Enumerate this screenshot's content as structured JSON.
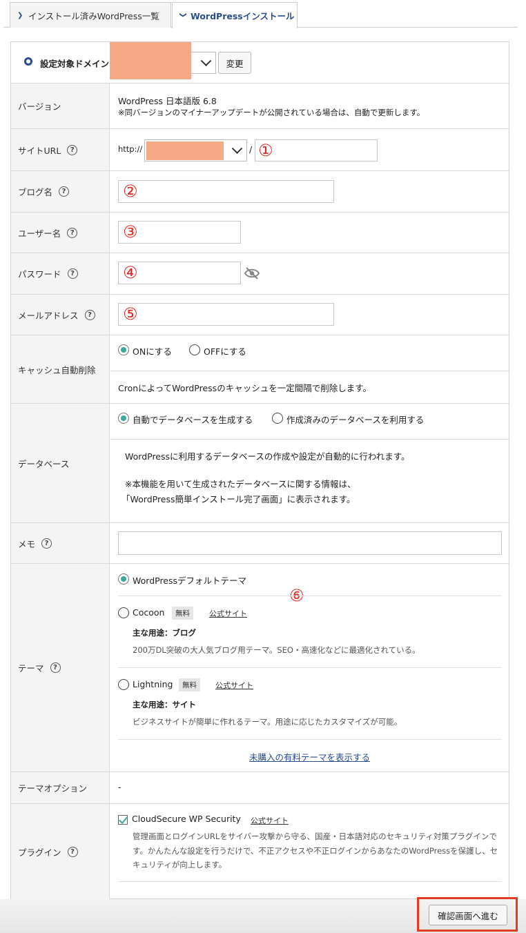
{
  "tabs": {
    "installed_list": "インストール済みWordPress一覧",
    "install": "WordPressインストール"
  },
  "domain": {
    "label": "設定対象ドメイン",
    "change_button": "変更"
  },
  "version": {
    "label": "バージョン",
    "value": "WordPress 日本語版 6.8",
    "note": "※同バージョンのマイナーアップデートが公開されている場合は、自動で更新します。"
  },
  "site_url": {
    "label": "サイトURL",
    "scheme": "http://",
    "separator": "/",
    "marker": "①"
  },
  "blog_name": {
    "label": "ブログ名",
    "marker": "②"
  },
  "username": {
    "label": "ユーザー名",
    "marker": "③"
  },
  "password": {
    "label": "パスワード",
    "marker": "④"
  },
  "email": {
    "label": "メールアドレス",
    "marker": "⑤"
  },
  "cache": {
    "label": "キャッシュ自動削除",
    "on": "ONにする",
    "off": "OFFにする",
    "desc": "CronによってWordPressのキャッシュを一定間隔で削除します。"
  },
  "database": {
    "label": "データベース",
    "auto": "自動でデータベースを生成する",
    "existing": "作成済みのデータベースを利用する",
    "desc1": "WordPressに利用するデータベースの作成や設定が自動的に行われます。",
    "desc2": "※本機能を用いて生成されたデータベースに関する情報は、",
    "desc3": "「WordPress簡単インストール完了画面」に表示されます。"
  },
  "memo": {
    "label": "メモ"
  },
  "theme": {
    "label": "テーマ",
    "marker": "⑥",
    "default": "WordPressデフォルトテーマ",
    "cocoon": {
      "name": "Cocoon",
      "badge": "無料",
      "link": "公式サイト",
      "use": "主な用途：ブログ",
      "desc": "200万DL突破の大人気ブログ用テーマ。SEO・高速化などに最適化されている。"
    },
    "lightning": {
      "name": "Lightning",
      "badge": "無料",
      "link": "公式サイト",
      "use": "主な用途：サイト",
      "desc": "ビジネスサイトが簡単に作れるテーマ。用途に応じたカスタマイズが可能。"
    },
    "show_paid": "未購入の有料テーマを表示する"
  },
  "theme_option": {
    "label": "テーマオプション",
    "value": "-"
  },
  "plugin": {
    "label": "プラグイン",
    "name": "CloudSecure WP Security",
    "link": "公式サイト",
    "desc1": "管理画面とログインURLをサイバー攻撃から守る、国産・日本語対応のセキュリティ対策プラグインで",
    "desc2": "す。かんたんな設定を行うだけで、不正アクセスや不正ログインからあなたのWordPressを保護し、セ",
    "desc3": "キュリティが向上します。"
  },
  "footer": {
    "submit": "確認画面へ進む"
  },
  "colors": {
    "accent": "#2a4d8f",
    "marker": "#e0261f",
    "redact": "#f5a986",
    "radio_on": "#3aa89a",
    "highlight": "#e53b22"
  }
}
